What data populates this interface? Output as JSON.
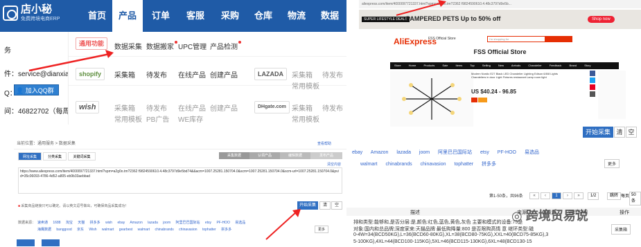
{
  "p1": {
    "logo_text": "店小秘",
    "logo_sub": "免费跨境电商ERP",
    "nav": [
      "首页",
      "产品",
      "订单",
      "客服",
      "采购",
      "仓库",
      "物流",
      "数据"
    ],
    "side": {
      "line1": "务",
      "line2": "件：service@dianxiaomi",
      "line3": "Q：",
      "qq_label": "加入QQ群",
      "line4": "间：46822702（每周三"
    },
    "common": {
      "badge": "通用功能",
      "items": [
        "数据采集",
        "数据搬家",
        "UPC管理",
        "产品检测"
      ]
    },
    "shopify": {
      "logo": "shopify",
      "items": [
        "采集箱",
        "待发布",
        "在线产品",
        "创建产品"
      ]
    },
    "lazada": {
      "logo": "LAZADA",
      "items": [
        "采集箱",
        "待发布",
        "常用模板"
      ]
    },
    "wish": {
      "logo": "wish",
      "items": [
        "采集箱",
        "待发布",
        "在线产品",
        "创建产品"
      ],
      "row2": [
        "常用模板",
        "PB广告",
        "WE库存"
      ]
    },
    "dhgate": {
      "logo": "DHgate.com",
      "items": [
        "采集箱",
        "待发布",
        "常用模板"
      ]
    }
  },
  "p2": {
    "url": "aliexpress.com/item/4000097721337.html?spm=a2g0o.tm?2362 f9824590610.4.48c3797d9e5b...",
    "badge": "SUPER LIFESTYLE DEALS",
    "banner": "PAMPERED PETS  Up to 50% off",
    "shop_now": "Shop now",
    "ali": "AliExpress",
    "fss": "FSS Official Store",
    "search_placeholder": "I'm shopping for",
    "store_title": "FSS Official Store",
    "store_nav": "Store Home Products Sale Items Top Selling New Arrivals Chandelier Feedback Brand Story",
    "product_title": "Modern Nordic E27 Black LED Chandelier Lighting Edison 6/8/8 Lights Chandeliers in door Light Fixtures restaurant Lamp room light",
    "price": "US $40.24 - 96.85",
    "collect": "开始采集",
    "clear": "清",
    "empty": "空"
  },
  "p3": {
    "crumb": "当前位置：通用服务 > 数据采集",
    "help": "查看帮助",
    "tabs": [
      "网址采集",
      "分类采集",
      "关键词采集"
    ],
    "steps": [
      "采集数据",
      "认领产品",
      "编辑数据",
      "发布产品"
    ],
    "url_text": "https://www.aliexpress.com/item/4000097721337.html?spm=a2g0o.tm?2362 f9824590610.4.48c3797d9e5bd74&&acm=1007.25281.150704.0&scm=1007.25281.150704.0&scm-url=1007.25281.150704.0&pvid=35c06093-4786-4d52-a805-eb9b33aebbad",
    "clear_link": "清空内容",
    "warn": "采集商品链接只可以确定。请以英文逗号做出，可确保商品采集成功！",
    "collect": "开始采集",
    "clear": "清",
    "empty": "空",
    "platforms_label": "数据来源：",
    "platforms": "速卖通 1688 淘宝 天猫 拼多多 wish ebay Amazon lazada joom 阿里巴巴国际站 etsy PF-HOO 易选品",
    "platforms2": "海鹰数据 banggood 京东 Wish walmart gearbest walmart chinabrands chinavasion tophatter 拼多多",
    "more": "更多"
  },
  "p4": {
    "platforms": "ebay Amazon lazada joom 阿里巴巴国际站 etsy PF-HOO 易选品",
    "platforms2": "walmart chinabrands chinavasion tophatter 拼多多",
    "more": "更多",
    "count": "第1-50条，共96条",
    "pages": [
      "«",
      "‹",
      "1",
      "›",
      "»",
      "1/2",
      "跳转"
    ],
    "per_page_label": "每页",
    "per_page": "50条",
    "headers": [
      "描述",
      "来源",
      "负责人",
      "创建时间",
      "操作"
    ],
    "row1": "排和类型:能够和,是否分层:是,颜色:红色,蓝色,黄色,灰色 主要和模式的设备:75是",
    "row2": "对象:国内和总品牌;深度家来:天猫品牌 最低购降量:800 是否限购高情 意 继环类型:磁",
    "row3": "0-4W=34(BCD50KG),L=36(BCD60-80KG),XL=38(BCD80-75KG),XXL=40(BCD75-85KG),3",
    "row4": "5-100KG),4XL=44(BCD100-115KG),5XL=46(BCD115-130KG),6XL=48(BCD130-15",
    "action": "采集箱",
    "watermark": "跨境贸易说"
  }
}
